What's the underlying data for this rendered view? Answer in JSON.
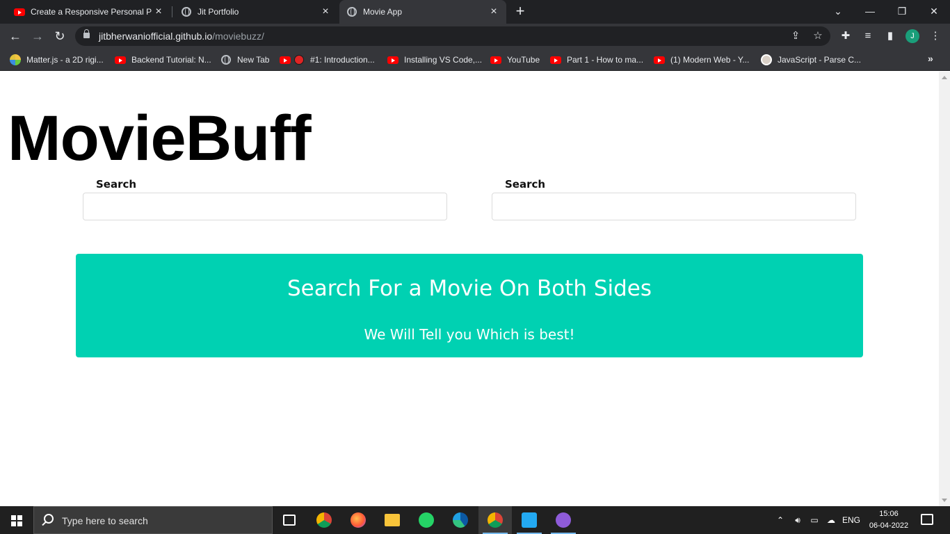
{
  "browser": {
    "tabs": [
      {
        "title": "Create a Responsive Personal Por",
        "icon": "youtube-icon",
        "active": false
      },
      {
        "title": "Jit Portfolio",
        "icon": "globe-icon",
        "active": false
      },
      {
        "title": "Movie App",
        "icon": "globe-icon",
        "active": true
      }
    ],
    "url_host": "jitbherwaniofficial.github.io",
    "url_path": "/moviebuzz/",
    "profile_initial": "J"
  },
  "bookmarks": [
    {
      "label": "Matter.js - a 2D rigi...",
      "icon": "matterjs-icon"
    },
    {
      "label": "Backend Tutorial: N...",
      "icon": "youtube-icon"
    },
    {
      "label": "New Tab",
      "icon": "globe-icon"
    },
    {
      "label": "#1: Introduction...",
      "icon": "youtube-icon"
    },
    {
      "label": "Installing VS Code,...",
      "icon": "youtube-icon"
    },
    {
      "label": "YouTube",
      "icon": "youtube-icon"
    },
    {
      "label": "Part 1 - How to ma...",
      "icon": "youtube-icon"
    },
    {
      "label": "(1) Modern Web - Y...",
      "icon": "youtube-icon"
    },
    {
      "label": "JavaScript - Parse C...",
      "icon": "avatar-icon"
    }
  ],
  "page": {
    "brand": "MovieBuff",
    "left_search_label": "Search",
    "right_search_label": "Search",
    "left_search_value": "",
    "right_search_value": "",
    "notice_title": "Search For a Movie On Both Sides",
    "notice_subtitle": "We Will Tell you Which is best!",
    "notice_color": "#00d1b2"
  },
  "taskbar": {
    "search_placeholder": "Type here to search",
    "language": "ENG",
    "time": "15:06",
    "date": "06-04-2022"
  }
}
